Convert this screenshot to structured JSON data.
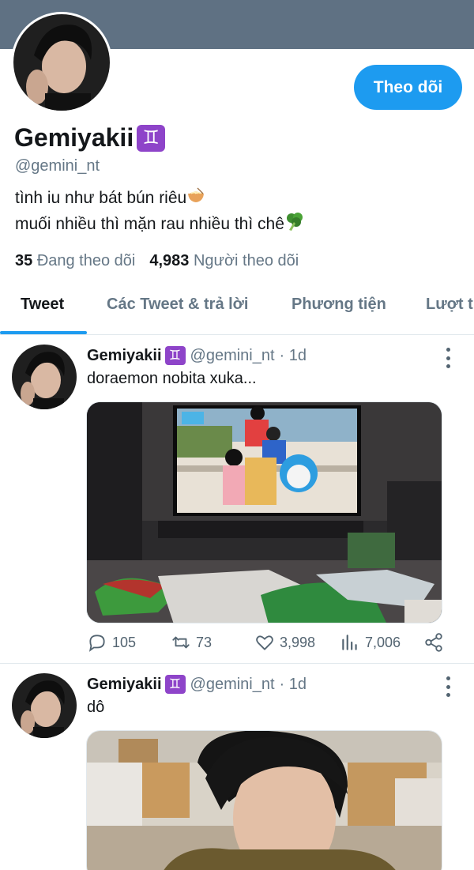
{
  "profile": {
    "display_name": "Gemiyakii",
    "zodiac_badge": "♊",
    "handle": "@gemini_nt",
    "bio_line1": "tình iu như bát bún riêu",
    "bio_line2": "muối nhiều thì mặn rau nhiều thì chê",
    "bio_emoji1": "noodle-bowl-emoji",
    "bio_emoji2": "broccoli-emoji",
    "following_count": "35",
    "following_label": "Đang theo dõi",
    "followers_count": "4,983",
    "followers_label": "Người theo dõi"
  },
  "follow_button": {
    "label": "Theo dõi"
  },
  "tabs": [
    {
      "label": "Tweet",
      "active": true
    },
    {
      "label": "Các Tweet & trả lời",
      "active": false
    },
    {
      "label": "Phương tiện",
      "active": false
    },
    {
      "label": "Lượt th",
      "active": false
    }
  ],
  "tweets": [
    {
      "name": "Gemiyakii",
      "handle": "@gemini_nt",
      "time": "· 1d",
      "text": "doraemon nobita xuka...",
      "media_kind": "photo of tv showing cartoon",
      "replies": "105",
      "retweets": "73",
      "likes": "3,998",
      "views": "7,006"
    },
    {
      "name": "Gemiyakii",
      "handle": "@gemini_nt",
      "time": "· 1d",
      "text": "dô",
      "media_kind": "photo of person"
    }
  ],
  "colors": {
    "accent": "#1d9bf0",
    "banner": "#5f7183",
    "secondary_text": "#657786",
    "zodiac_badge": "#8e44c9"
  }
}
